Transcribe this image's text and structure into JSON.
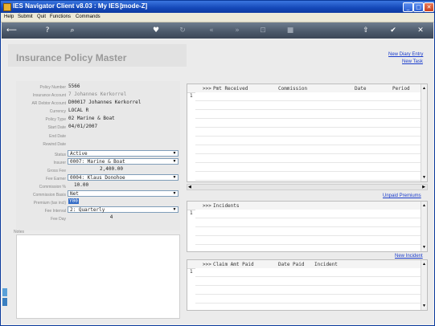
{
  "window": {
    "title": "IES Navigator Client v8.03 : My IES :",
    "mode": "[mode-Z]",
    "controls": {
      "minimize": "_",
      "maximize": "□",
      "close": "✕"
    }
  },
  "menu": [
    "Help",
    "Submit",
    "Quit",
    "Functions",
    "Commands"
  ],
  "toolbar": {
    "icons": [
      "back-icon",
      "help-icon",
      "search-icon",
      "favorite-icon",
      "refresh-icon",
      "first-icon",
      "last-icon",
      "lock-icon",
      "stop-icon",
      "up-icon",
      "ok-icon",
      "close-icon"
    ]
  },
  "page": {
    "title": "Insurance Policy Master",
    "links": {
      "new_diary": "New Diary Entry",
      "new_task": "New Task"
    }
  },
  "form": {
    "labels": {
      "policy_number": "Policy Number",
      "insurance_account": "Insurance Account",
      "ar_debtor_account": "AR Debtor Account",
      "currency": "Currency",
      "policy_type": "Policy Type",
      "start_date": "Start Date",
      "end_date": "End Date",
      "rewind_date": "Rewind Date",
      "status": "Status",
      "insurer": "Insurer",
      "gross_fee": "Gross Fee",
      "fee_earner": "Fee Earner",
      "commission_pct": "Commission %",
      "commission_basis": "Commission Basis",
      "premium_tax_incl": "Premium (tax incl)",
      "fee_interval": "Fee Interval",
      "fee_day": "Fee Day",
      "notes": "Notes"
    },
    "values": {
      "policy_number": "5566",
      "insurance_account": "7 Johannes Kerkorrel",
      "ar_debtor_account": "D00017 Johannes Kerkorrel",
      "currency": "LOCAL R",
      "policy_type": "02 Marine & Boat",
      "start_date": "04/01/2007",
      "end_date": "",
      "rewind_date": "",
      "status": "Active",
      "insurer": "0007: Marine & Boat",
      "gross_fee": "2,400.00",
      "fee_earner": "0004: Klaus Donohoe",
      "commission_pct": "10.00",
      "commission_basis": "Net",
      "premium_tax_incl": "Y00",
      "fee_interval": "2: Quarterly",
      "fee_day": "4"
    }
  },
  "grids": {
    "payments": {
      "columns": [
        ">>>",
        "Pmt Received",
        "Commission",
        "Date",
        "Period"
      ],
      "rows": [
        "1"
      ]
    },
    "incidents": {
      "columns": [
        ">>>",
        "Incidents"
      ],
      "rows": [
        "1"
      ],
      "link": "Unpaid Premiums"
    },
    "claims": {
      "columns": [
        ">>>",
        "Claim Amt Paid",
        "Date Paid",
        "Incident"
      ],
      "rows": [
        "1"
      ],
      "link": "New Incident"
    }
  }
}
